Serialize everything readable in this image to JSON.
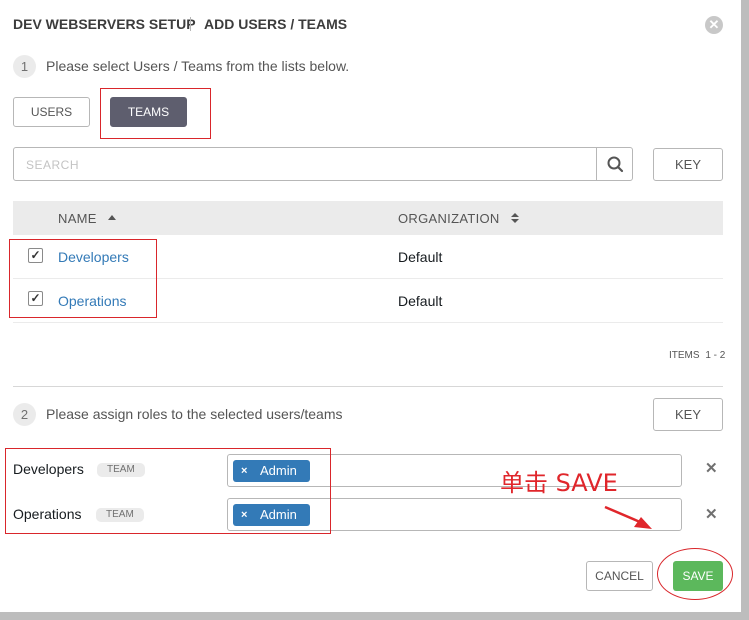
{
  "header": {
    "title": "DEV WEBSERVERS SETUP",
    "subtitle": "ADD USERS / TEAMS",
    "close_icon": "close-circle-icon"
  },
  "step1": {
    "number": "1",
    "text": "Please select Users / Teams from the lists below."
  },
  "toggle": {
    "users_label": "USERS",
    "teams_label": "TEAMS",
    "selected": "TEAMS"
  },
  "search": {
    "placeholder": "SEARCH",
    "key_label": "KEY",
    "icon": "search-icon"
  },
  "table": {
    "columns": [
      "NAME",
      "ORGANIZATION"
    ],
    "rows": [
      {
        "name": "Developers",
        "organization": "Default",
        "checked": true
      },
      {
        "name": "Operations",
        "organization": "Default",
        "checked": true
      }
    ],
    "items_label": "ITEMS",
    "items_range": "1 - 2"
  },
  "step2": {
    "number": "2",
    "text": "Please assign roles to the selected users/teams",
    "key_label": "KEY"
  },
  "roles": [
    {
      "name": "Developers",
      "badge": "TEAM",
      "tag": "Admin"
    },
    {
      "name": "Operations",
      "badge": "TEAM",
      "tag": "Admin"
    }
  ],
  "annotation": {
    "text": "单击 SAVE",
    "color": "#e0262b"
  },
  "footer": {
    "cancel_label": "CANCEL",
    "save_label": "SAVE"
  },
  "colors": {
    "link": "#337ab7",
    "tag": "#337ab7",
    "save": "#5cb85c",
    "toggle_active": "#5e5e6e",
    "highlight": "#d9262b"
  }
}
